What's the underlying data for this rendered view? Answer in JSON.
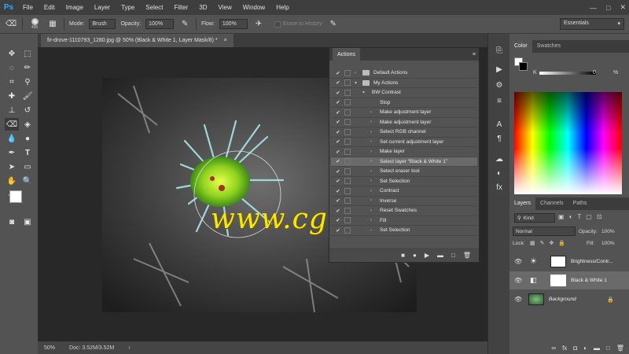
{
  "app": {
    "logo": "Ps"
  },
  "menu": [
    "File",
    "Edit",
    "Image",
    "Layer",
    "Type",
    "Select",
    "Filter",
    "3D",
    "View",
    "Window",
    "Help"
  ],
  "window_controls": [
    "—",
    "□",
    "✕"
  ],
  "options": {
    "brush_size": "495",
    "mode_label": "Mode:",
    "mode_value": "Brush",
    "opacity_label": "Opacity:",
    "opacity_value": "100%",
    "flow_label": "Flow:",
    "flow_value": "100%",
    "erase_history": "Erase to History",
    "workspace": "Essentials"
  },
  "document": {
    "tab_title": "fir-drove-1110793_1280.jpg @ 50% (Black & White 1, Layer Mask/8) *",
    "close": "×"
  },
  "status": {
    "zoom": "50%",
    "doc_info": "Doc: 3.52M/3.52M"
  },
  "watermark": "www.cgtsj.com",
  "actions": {
    "title": "Actions",
    "rows": [
      {
        "label": "Default Actions",
        "type": "set",
        "indent": 0,
        "expanded": false
      },
      {
        "label": "My Actions",
        "type": "set",
        "indent": 0,
        "expanded": true
      },
      {
        "label": "BW Contrast",
        "type": "action",
        "indent": 1,
        "expanded": true
      },
      {
        "label": "Stop",
        "type": "step",
        "indent": 2
      },
      {
        "label": "Make adjustment layer",
        "type": "step",
        "indent": 2
      },
      {
        "label": "Make adjustment layer",
        "type": "step",
        "indent": 2
      },
      {
        "label": "Select RGB channel",
        "type": "step",
        "indent": 2
      },
      {
        "label": "Set current adjustment layer",
        "type": "step",
        "indent": 2
      },
      {
        "label": "Make layer",
        "type": "step",
        "indent": 2
      },
      {
        "label": "Select layer “Black & White 1”",
        "type": "step",
        "indent": 2
      },
      {
        "label": "Select eraser tool",
        "type": "step",
        "indent": 2
      },
      {
        "label": "Set Selection",
        "type": "step",
        "indent": 2
      },
      {
        "label": "Contract",
        "type": "step",
        "indent": 2
      },
      {
        "label": "Inverse",
        "type": "step",
        "indent": 2
      },
      {
        "label": "Reset Swatches",
        "type": "step",
        "indent": 2
      },
      {
        "label": "Fill",
        "type": "step",
        "indent": 2
      },
      {
        "label": "Set Selection",
        "type": "step",
        "indent": 2
      }
    ],
    "footer_icons": [
      "■",
      "●",
      "▶",
      "▬",
      "□",
      "🗑"
    ]
  },
  "color_panel": {
    "tabs": [
      "Color",
      "Swatches"
    ],
    "slider_label": "K",
    "slider_value": "0",
    "slider_unit": "%"
  },
  "layers_panel": {
    "tabs": [
      "Layers",
      "Channels",
      "Paths"
    ],
    "kind": "Kind",
    "blend_mode": "Normal",
    "opacity_label": "Opacity:",
    "opacity_value": "100%",
    "lock_label": "Lock:",
    "fill_label": "Fill:",
    "fill_value": "100%",
    "layers": [
      {
        "name": "Brightness/Contr...",
        "italic": false
      },
      {
        "name": "Black & White 1",
        "italic": false
      },
      {
        "name": "Background",
        "italic": true
      }
    ]
  }
}
